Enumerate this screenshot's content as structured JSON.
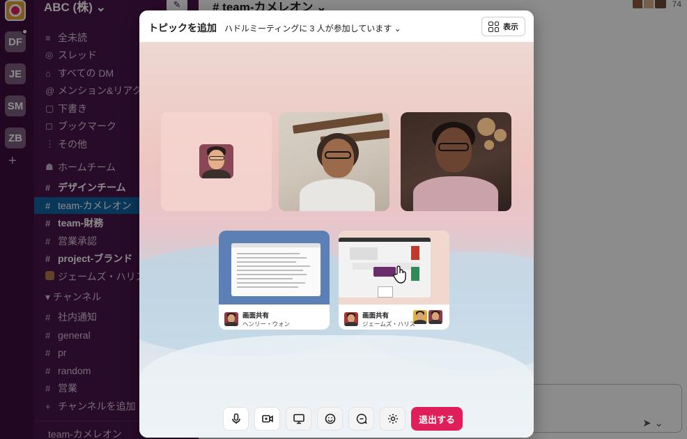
{
  "workspace_rail": {
    "items": [
      "DF",
      "JE",
      "SM",
      "ZB"
    ],
    "add_label": "+"
  },
  "sidebar": {
    "workspace_name": "ABC (株) ⌄",
    "nav": [
      {
        "icon": "≡",
        "label": "全未読"
      },
      {
        "icon": "◎",
        "label": "スレッド"
      },
      {
        "icon": "⌂",
        "label": "すべての DM"
      },
      {
        "icon": "@",
        "label": "メンション&リアクシ"
      },
      {
        "icon": "▢",
        "label": "下書き"
      },
      {
        "icon": "◻",
        "label": "ブックマーク"
      },
      {
        "icon": "⋮",
        "label": "その他"
      }
    ],
    "section_home": "ホームチーム",
    "home_channels": [
      {
        "prefix": "#",
        "label": "デザインチーム",
        "style": "bold"
      },
      {
        "prefix": "#",
        "label": "team-カメレオン",
        "style": "active"
      },
      {
        "prefix": "#",
        "label": "team-財務",
        "style": "bold"
      },
      {
        "prefix": "#",
        "label": "営業承認",
        "style": "normal"
      },
      {
        "prefix": "#",
        "label": "project-ブランド",
        "style": "bold"
      },
      {
        "prefix": "",
        "label": "ジェームズ・ハリス",
        "style": "normal"
      }
    ],
    "section_channels": "▾ チャンネル",
    "channels": [
      {
        "prefix": "#",
        "label": "社内通知"
      },
      {
        "prefix": "#",
        "label": "general"
      },
      {
        "prefix": "#",
        "label": "pr"
      },
      {
        "prefix": "#",
        "label": "random"
      },
      {
        "prefix": "#",
        "label": "営業"
      },
      {
        "prefix": "+",
        "label": "チャンネルを追加"
      }
    ],
    "footer": "team-カメレオン"
  },
  "main": {
    "channel_title": "# team-カメレオン ⌄",
    "member_count": "74"
  },
  "huddle": {
    "title": "トピックを追加",
    "subtitle": "ハドルミーティングに 3 人が参加しています ⌄",
    "view_button": "表示",
    "shares": [
      {
        "title": "画面共有",
        "name": "ヘンリー・ウォン"
      },
      {
        "title": "画面共有",
        "name": "ジェームズ・ハリス"
      }
    ],
    "controls": [
      "mic-icon",
      "camera-icon",
      "screen-share-icon",
      "emoji-icon",
      "chat-icon",
      "settings-icon"
    ],
    "leave_button": "退出する"
  },
  "colors": {
    "rail": "#3f0e40",
    "sidebar": "#4a154b",
    "active": "#1164a3",
    "leave": "#e01e5a"
  }
}
